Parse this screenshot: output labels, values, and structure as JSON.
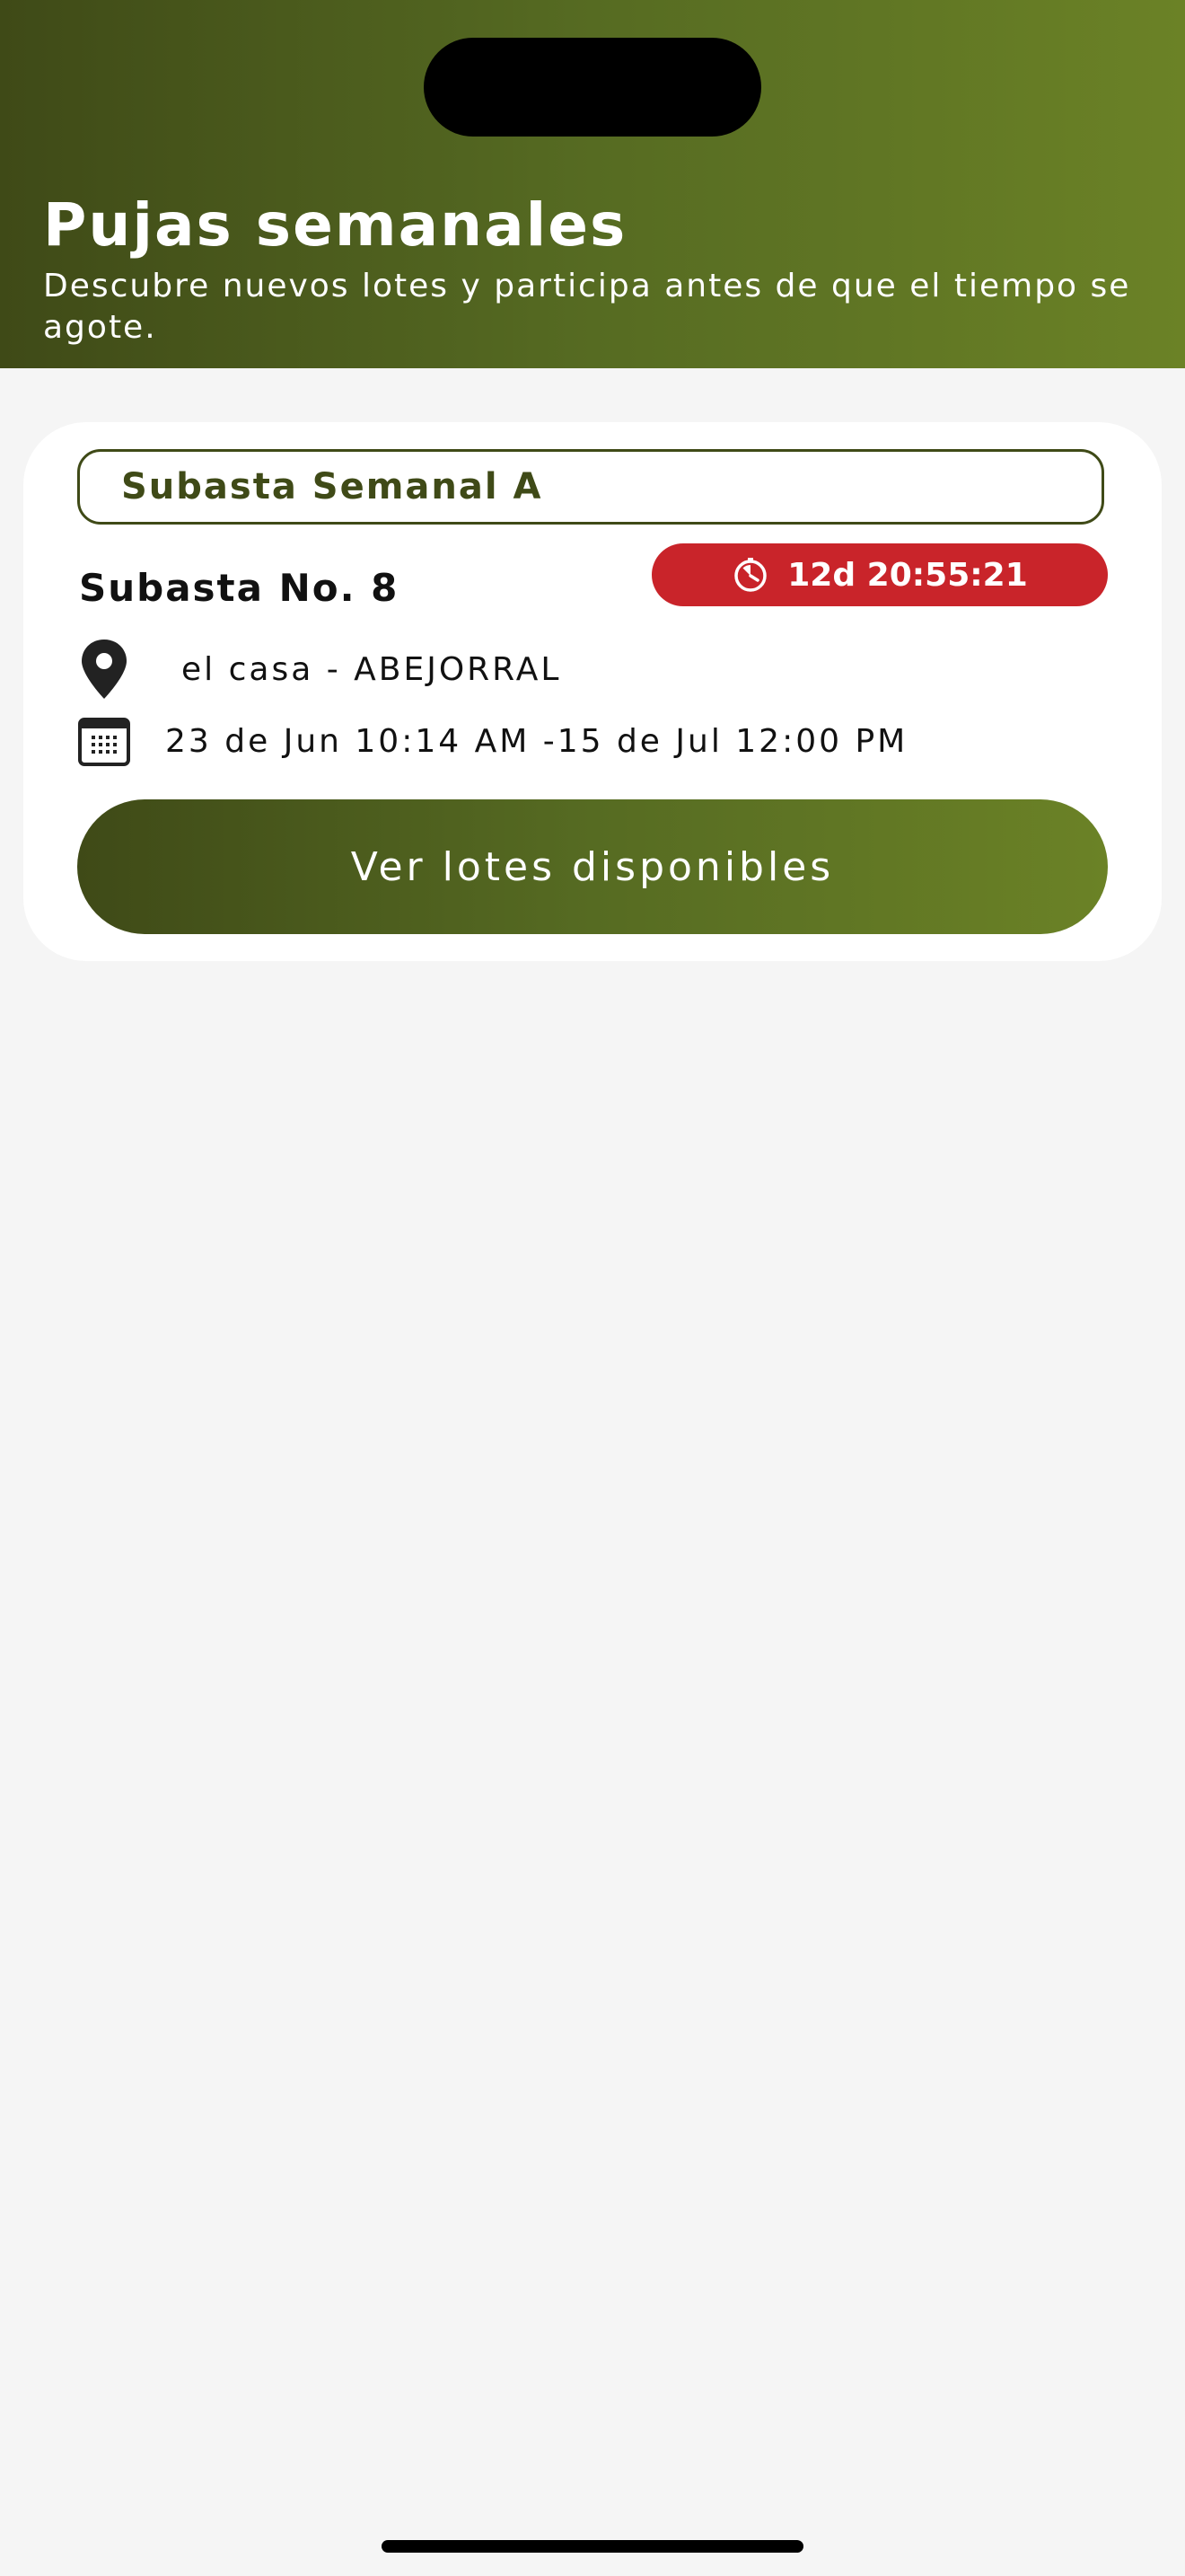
{
  "header": {
    "title": "Pujas semanales",
    "subtitle": "Descubre nuevos lotes y participa antes de que el tiempo se agote."
  },
  "auction_card": {
    "type_label": "Subasta Semanal A",
    "number_label": "Subasta No. 8",
    "timer": {
      "icon": "stopwatch-icon",
      "text": "12d 20:55:21",
      "color": "#c9242a"
    },
    "location": {
      "icon": "location-pin-icon",
      "text": "el casa - ABEJORRAL"
    },
    "dates": {
      "icon": "calendar-icon",
      "text": "23 de Jun 10:14 AM -15 de Jul 12:00 PM"
    },
    "cta_label": "Ver lotes disponibles"
  },
  "colors": {
    "brand_dark": "#3f4a17",
    "brand_light": "#6b8226",
    "timer_red": "#c9242a",
    "background": "#f5f5f5"
  }
}
